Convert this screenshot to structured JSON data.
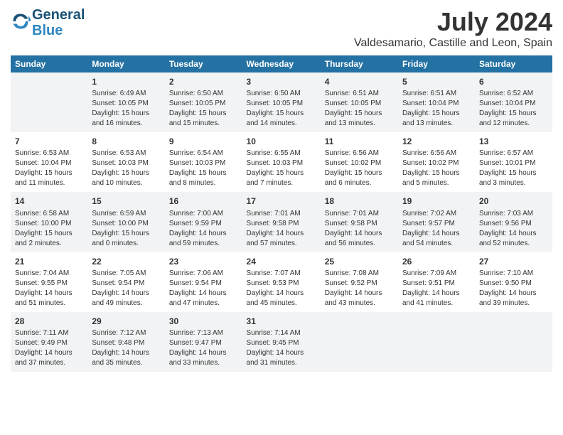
{
  "header": {
    "logo_line1": "General",
    "logo_line2": "Blue",
    "month": "July 2024",
    "location": "Valdesamario, Castille and Leon, Spain"
  },
  "columns": [
    "Sunday",
    "Monday",
    "Tuesday",
    "Wednesday",
    "Thursday",
    "Friday",
    "Saturday"
  ],
  "weeks": [
    [
      {
        "day": "",
        "info": ""
      },
      {
        "day": "1",
        "info": "Sunrise: 6:49 AM\nSunset: 10:05 PM\nDaylight: 15 hours\nand 16 minutes."
      },
      {
        "day": "2",
        "info": "Sunrise: 6:50 AM\nSunset: 10:05 PM\nDaylight: 15 hours\nand 15 minutes."
      },
      {
        "day": "3",
        "info": "Sunrise: 6:50 AM\nSunset: 10:05 PM\nDaylight: 15 hours\nand 14 minutes."
      },
      {
        "day": "4",
        "info": "Sunrise: 6:51 AM\nSunset: 10:05 PM\nDaylight: 15 hours\nand 13 minutes."
      },
      {
        "day": "5",
        "info": "Sunrise: 6:51 AM\nSunset: 10:04 PM\nDaylight: 15 hours\nand 13 minutes."
      },
      {
        "day": "6",
        "info": "Sunrise: 6:52 AM\nSunset: 10:04 PM\nDaylight: 15 hours\nand 12 minutes."
      }
    ],
    [
      {
        "day": "7",
        "info": "Sunrise: 6:53 AM\nSunset: 10:04 PM\nDaylight: 15 hours\nand 11 minutes."
      },
      {
        "day": "8",
        "info": "Sunrise: 6:53 AM\nSunset: 10:03 PM\nDaylight: 15 hours\nand 10 minutes."
      },
      {
        "day": "9",
        "info": "Sunrise: 6:54 AM\nSunset: 10:03 PM\nDaylight: 15 hours\nand 8 minutes."
      },
      {
        "day": "10",
        "info": "Sunrise: 6:55 AM\nSunset: 10:03 PM\nDaylight: 15 hours\nand 7 minutes."
      },
      {
        "day": "11",
        "info": "Sunrise: 6:56 AM\nSunset: 10:02 PM\nDaylight: 15 hours\nand 6 minutes."
      },
      {
        "day": "12",
        "info": "Sunrise: 6:56 AM\nSunset: 10:02 PM\nDaylight: 15 hours\nand 5 minutes."
      },
      {
        "day": "13",
        "info": "Sunrise: 6:57 AM\nSunset: 10:01 PM\nDaylight: 15 hours\nand 3 minutes."
      }
    ],
    [
      {
        "day": "14",
        "info": "Sunrise: 6:58 AM\nSunset: 10:00 PM\nDaylight: 15 hours\nand 2 minutes."
      },
      {
        "day": "15",
        "info": "Sunrise: 6:59 AM\nSunset: 10:00 PM\nDaylight: 15 hours\nand 0 minutes."
      },
      {
        "day": "16",
        "info": "Sunrise: 7:00 AM\nSunset: 9:59 PM\nDaylight: 14 hours\nand 59 minutes."
      },
      {
        "day": "17",
        "info": "Sunrise: 7:01 AM\nSunset: 9:58 PM\nDaylight: 14 hours\nand 57 minutes."
      },
      {
        "day": "18",
        "info": "Sunrise: 7:01 AM\nSunset: 9:58 PM\nDaylight: 14 hours\nand 56 minutes."
      },
      {
        "day": "19",
        "info": "Sunrise: 7:02 AM\nSunset: 9:57 PM\nDaylight: 14 hours\nand 54 minutes."
      },
      {
        "day": "20",
        "info": "Sunrise: 7:03 AM\nSunset: 9:56 PM\nDaylight: 14 hours\nand 52 minutes."
      }
    ],
    [
      {
        "day": "21",
        "info": "Sunrise: 7:04 AM\nSunset: 9:55 PM\nDaylight: 14 hours\nand 51 minutes."
      },
      {
        "day": "22",
        "info": "Sunrise: 7:05 AM\nSunset: 9:54 PM\nDaylight: 14 hours\nand 49 minutes."
      },
      {
        "day": "23",
        "info": "Sunrise: 7:06 AM\nSunset: 9:54 PM\nDaylight: 14 hours\nand 47 minutes."
      },
      {
        "day": "24",
        "info": "Sunrise: 7:07 AM\nSunset: 9:53 PM\nDaylight: 14 hours\nand 45 minutes."
      },
      {
        "day": "25",
        "info": "Sunrise: 7:08 AM\nSunset: 9:52 PM\nDaylight: 14 hours\nand 43 minutes."
      },
      {
        "day": "26",
        "info": "Sunrise: 7:09 AM\nSunset: 9:51 PM\nDaylight: 14 hours\nand 41 minutes."
      },
      {
        "day": "27",
        "info": "Sunrise: 7:10 AM\nSunset: 9:50 PM\nDaylight: 14 hours\nand 39 minutes."
      }
    ],
    [
      {
        "day": "28",
        "info": "Sunrise: 7:11 AM\nSunset: 9:49 PM\nDaylight: 14 hours\nand 37 minutes."
      },
      {
        "day": "29",
        "info": "Sunrise: 7:12 AM\nSunset: 9:48 PM\nDaylight: 14 hours\nand 35 minutes."
      },
      {
        "day": "30",
        "info": "Sunrise: 7:13 AM\nSunset: 9:47 PM\nDaylight: 14 hours\nand 33 minutes."
      },
      {
        "day": "31",
        "info": "Sunrise: 7:14 AM\nSunset: 9:45 PM\nDaylight: 14 hours\nand 31 minutes."
      },
      {
        "day": "",
        "info": ""
      },
      {
        "day": "",
        "info": ""
      },
      {
        "day": "",
        "info": ""
      }
    ]
  ]
}
